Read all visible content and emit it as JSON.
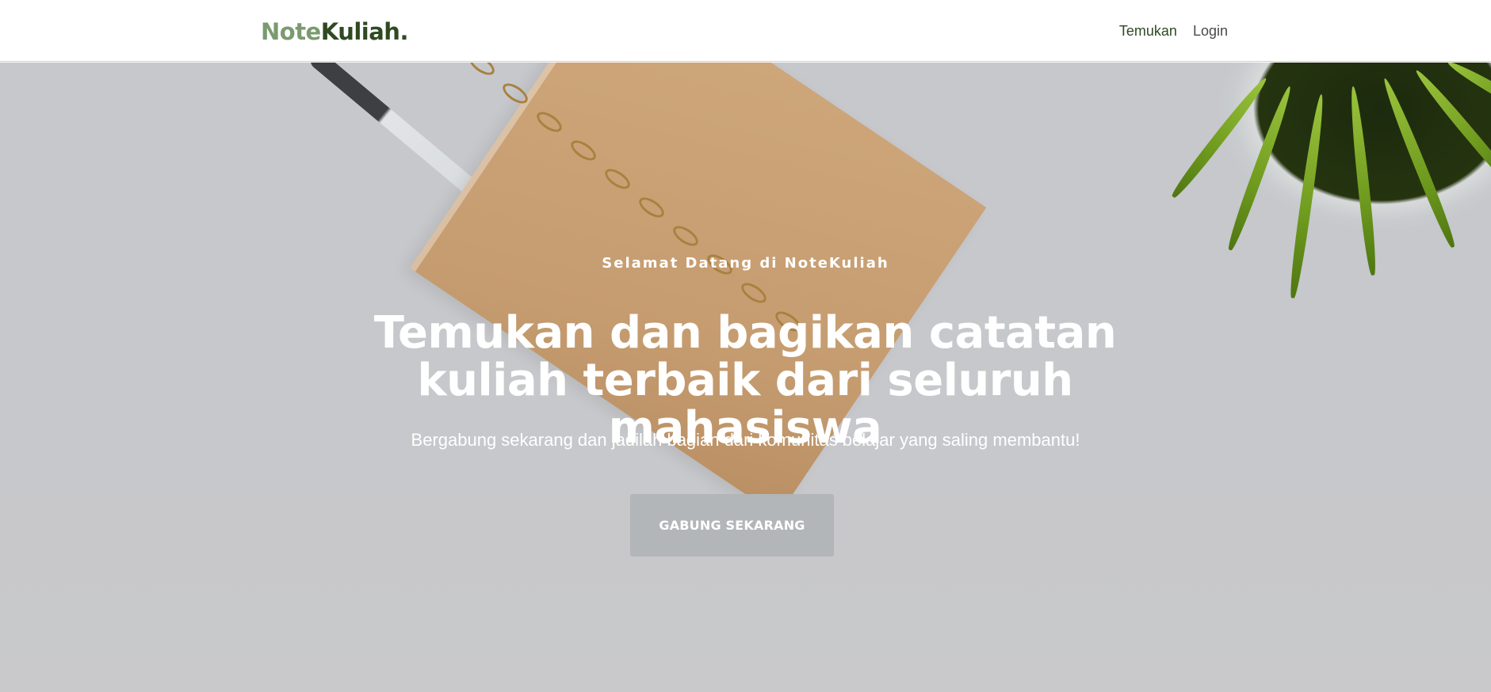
{
  "navbar": {
    "brand_part1": "Note",
    "brand_part2": "Kuliah.",
    "links": [
      {
        "label": "Temukan"
      },
      {
        "label": "Login"
      }
    ]
  },
  "hero": {
    "eyebrow": "Selamat Datang di NoteKuliah",
    "title": "Temukan dan bagikan catatan kuliah terbaik dari seluruh mahasiswa",
    "subtitle": "Bergabung sekarang dan jadilah bagian dari komunitas belajar yang saling membantu!",
    "cta_label": "GABUNG SEKARANG"
  },
  "colors": {
    "brand_light": "#7a9a6f",
    "brand_dark": "#2f4a22",
    "hero_bg": "#c6c8cc",
    "cta_bg": "#b3b6b8"
  }
}
